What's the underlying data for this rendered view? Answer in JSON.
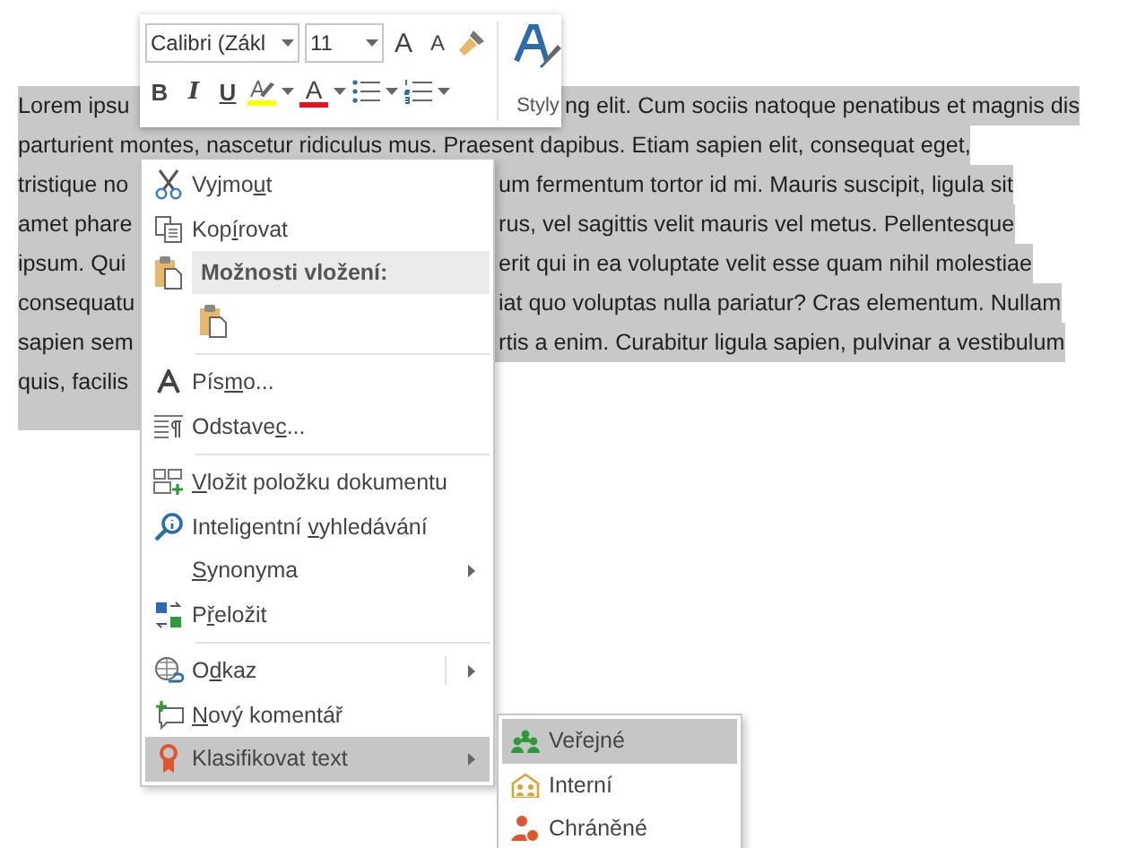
{
  "document": {
    "lines": [
      {
        "kind": "under_toolbar",
        "selected": true,
        "left": "Lorem ipsu",
        "right": "ng elit. Cum sociis natoque penatibus et magnis dis"
      },
      {
        "kind": "full",
        "selected": true,
        "left": "parturient montes, nascetur ridiculus mus. Praesent dapibus. Etiam sapien elit, consequat eget,"
      },
      {
        "kind": "under_menu",
        "selected": true,
        "left": "tristique no",
        "right": "um fermentum tortor id mi. Mauris suscipit, ligula sit"
      },
      {
        "kind": "under_menu",
        "selected": true,
        "left": "amet phare",
        "right": "rus, vel sagittis velit mauris vel metus. Pellentesque"
      },
      {
        "kind": "under_menu",
        "selected": true,
        "left": "ipsum. Qui",
        "right": "erit qui in ea voluptate velit esse quam nihil molestiae"
      },
      {
        "kind": "under_menu",
        "selected": true,
        "left": "consequatu",
        "right": "iat quo voluptas nulla pariatur? Cras elementum. Nullam"
      },
      {
        "kind": "under_menu",
        "selected": true,
        "left": "sapien sem",
        "right": "rtis a enim. Curabitur ligula sapien, pulvinar a vestibulum"
      },
      {
        "kind": "under_menu",
        "selected": true,
        "left": "quis, facilis"
      }
    ]
  },
  "mini_toolbar": {
    "font_name": "Calibri (Zákl",
    "font_size": "11",
    "grow_font": "A",
    "shrink_font": "A",
    "format_buttons": [
      {
        "kind": "bold",
        "label": "B"
      },
      {
        "kind": "italic",
        "label": "I"
      },
      {
        "kind": "underline",
        "label": "U"
      }
    ],
    "font_color": "A",
    "styles_label": "Styly"
  },
  "context_menu": {
    "items": [
      {
        "kind": "item",
        "label_parts": {
          "before": "Vyjmo",
          "key": "u",
          "after": "t"
        },
        "submenu": false,
        "split": false,
        "selected": false
      },
      {
        "kind": "item",
        "label_parts": {
          "before": "Kop",
          "key": "í",
          "after": "rovat"
        },
        "submenu": false,
        "split": false,
        "selected": false
      },
      {
        "kind": "header",
        "label": "Možnosti vložení:"
      },
      {
        "kind": "paste_options"
      },
      {
        "kind": "separator"
      },
      {
        "kind": "item",
        "label_parts": {
          "before": "Pís",
          "key": "m",
          "after": "o..."
        },
        "submenu": false,
        "split": false,
        "selected": false
      },
      {
        "kind": "item",
        "label_parts": {
          "before": "Odstave",
          "key": "c",
          "after": "..."
        },
        "submenu": false,
        "split": false,
        "selected": false
      },
      {
        "kind": "separator"
      },
      {
        "kind": "item",
        "label_parts": {
          "key": "V",
          "after": "ložit položku dokumentu"
        },
        "submenu": false,
        "split": false,
        "selected": false
      },
      {
        "kind": "item",
        "label_parts": {
          "before": "Inteligentní ",
          "key": "v",
          "after": "yhledávání"
        },
        "submenu": false,
        "split": false,
        "selected": false
      },
      {
        "kind": "item",
        "label_parts": {
          "key": "S",
          "after": "ynonyma"
        },
        "submenu": true,
        "split": false,
        "selected": false
      },
      {
        "kind": "item",
        "label_parts": {
          "before": "P",
          "key": "ř",
          "after": "eložit"
        },
        "submenu": false,
        "split": false,
        "selected": false
      },
      {
        "kind": "separator"
      },
      {
        "kind": "item",
        "label_parts": {
          "before": "O",
          "key": "d",
          "after": "kaz"
        },
        "submenu": true,
        "split": true,
        "selected": false
      },
      {
        "kind": "item",
        "label_parts": {
          "key": "N",
          "after": "ový komentář"
        },
        "submenu": false,
        "split": false,
        "selected": false
      },
      {
        "kind": "item",
        "label_parts": {
          "before": "Klasifikovat text"
        },
        "submenu": true,
        "split": false,
        "selected": true
      }
    ]
  },
  "submenu": {
    "items": [
      {
        "label": "Veřejné",
        "selected": true
      },
      {
        "label": "Interní",
        "selected": false
      },
      {
        "label": "Chráněné",
        "selected": false
      }
    ]
  }
}
